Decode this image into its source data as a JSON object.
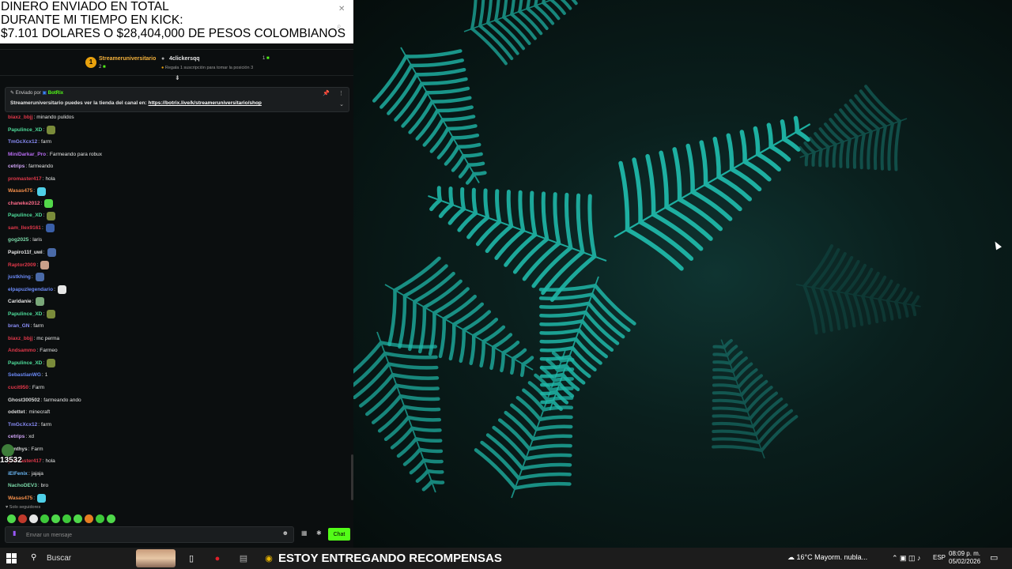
{
  "overlay": {
    "line1": "DINERO ENVIADO EN TOTAL",
    "line2": "DURANTE MI TIEMPO EN KICK:",
    "line3": "$7.101 DOLARES O $28,404,000 DE PESOS COLOMBIANOS"
  },
  "chat": {
    "title": "Chat",
    "leaderboard": {
      "first": {
        "rank": "1",
        "name": "Streameruniversitario",
        "count": "2"
      },
      "second": {
        "name": "4clickersqq",
        "count": "1",
        "hint": "Regala 1 suscripción para tomar la posición 3"
      }
    },
    "pinned": {
      "sent_by": "Enviado por",
      "sender": "BotRix",
      "message": "Streameruniversitario puedes ver la tienda del canal en:",
      "link": "https://botrix.live/k/streameruniversitario/shop"
    },
    "messages": [
      {
        "user": "biaxz_bbjj",
        "color": "#e0384a",
        "text": "minando pulidos",
        "emote": ""
      },
      {
        "user": "Papulince_XD",
        "color": "#4fdd9b",
        "text": "",
        "emote": "#7a8b3a"
      },
      {
        "user": "TmGcXcx12",
        "color": "#8a8df7",
        "text": "farm",
        "emote": ""
      },
      {
        "user": "MiniDarkar_Pro",
        "color": "#b86cf2",
        "text": "Farmeando para robux",
        "emote": ""
      },
      {
        "user": "cetrips",
        "color": "#d1a4f7",
        "text": "farmeando",
        "emote": ""
      },
      {
        "user": "promaster417",
        "color": "#e0384a",
        "text": "hola",
        "emote": ""
      },
      {
        "user": "Wasas475",
        "color": "#f38e4a",
        "text": "",
        "emote": "#4fd0e8"
      },
      {
        "user": "chaneke2012",
        "color": "#ff6b8a",
        "text": "",
        "emote": "#53d84a"
      },
      {
        "user": "Papulince_XD",
        "color": "#4fdd9b",
        "text": "",
        "emote": "#7a8b3a"
      },
      {
        "user": "sam_llex9161",
        "color": "#e0384a",
        "text": "",
        "emote": "#3a5fa8"
      },
      {
        "user": "gog2025",
        "color": "#7ad8a8",
        "text": "laris",
        "emote": ""
      },
      {
        "user": "Papiro11f_uwi",
        "color": "#e6e6e6",
        "text": "",
        "emote": "#4a6aa8"
      },
      {
        "user": "Raptor2009",
        "color": "#e0384a",
        "text": "",
        "emote": "#c9a08a"
      },
      {
        "user": "justkhing",
        "color": "#6b8af7",
        "text": "",
        "emote": "#4a6aa8"
      },
      {
        "user": "elpapuzlegendario",
        "color": "#6b8af7",
        "text": "",
        "emote": "#e6e6e6"
      },
      {
        "user": "Caridanie",
        "color": "#e6e6e6",
        "text": "",
        "emote": "#7aa87a"
      },
      {
        "user": "Papulince_XD",
        "color": "#4fdd9b",
        "text": "",
        "emote": "#7a8b3a"
      },
      {
        "user": "bran_GN",
        "color": "#8a8df7",
        "text": "farm",
        "emote": ""
      },
      {
        "user": "biaxz_bbjj",
        "color": "#e0384a",
        "text": "mc perma",
        "emote": ""
      },
      {
        "user": "Andsammo",
        "color": "#e0384a",
        "text": "Farmeo",
        "emote": ""
      },
      {
        "user": "Papulince_XD",
        "color": "#4fdd9b",
        "text": "",
        "emote": "#7a8b3a"
      },
      {
        "user": "SebastianWG",
        "color": "#6b8af7",
        "text": "1",
        "emote": ""
      },
      {
        "user": "cucit950",
        "color": "#e0384a",
        "text": "Farm",
        "emote": ""
      },
      {
        "user": "Ghost300502",
        "color": "#d8d8d8",
        "text": "farmeando ando",
        "emote": ""
      },
      {
        "user": "odettet",
        "color": "#d8d8d8",
        "text": "minecraft",
        "emote": ""
      },
      {
        "user": "TmGcXcx12",
        "color": "#8a8df7",
        "text": "farm",
        "emote": ""
      },
      {
        "user": "cetrips",
        "color": "#d1a4f7",
        "text": "xd",
        "emote": ""
      },
      {
        "user": "xanthys",
        "color": "#d8d8d8",
        "text": "Farm",
        "emote": ""
      },
      {
        "user": "promaster417",
        "color": "#e0384a",
        "text": "hola",
        "emote": ""
      },
      {
        "user": "iElFenix",
        "color": "#6bb8f7",
        "text": "jajaja",
        "emote": ""
      },
      {
        "user": "NachoDEV3",
        "color": "#7ad8a8",
        "text": "bro",
        "emote": ""
      },
      {
        "user": "Wasas475",
        "color": "#f38e4a",
        "text": "",
        "emote": "#4fd0e8"
      }
    ],
    "counter": "13532",
    "follow_only": "Solo seguidores",
    "input_placeholder": "Enviar un mensaje",
    "send_label": "Chat"
  },
  "taskbar": {
    "search_label": "Buscar",
    "banner": "ESTOY ENTREGANDO RECOMPENSAS",
    "weather": "16°C  Mayorm. nubla...",
    "lang": "ESP",
    "time": "08:09 p. m.",
    "date": "05/02/2026"
  },
  "colors": {
    "kick_green": "#53fc18",
    "gold": "#e8a10d",
    "chat_bg": "#0b0e0f",
    "fern": "#1fb7a8"
  }
}
